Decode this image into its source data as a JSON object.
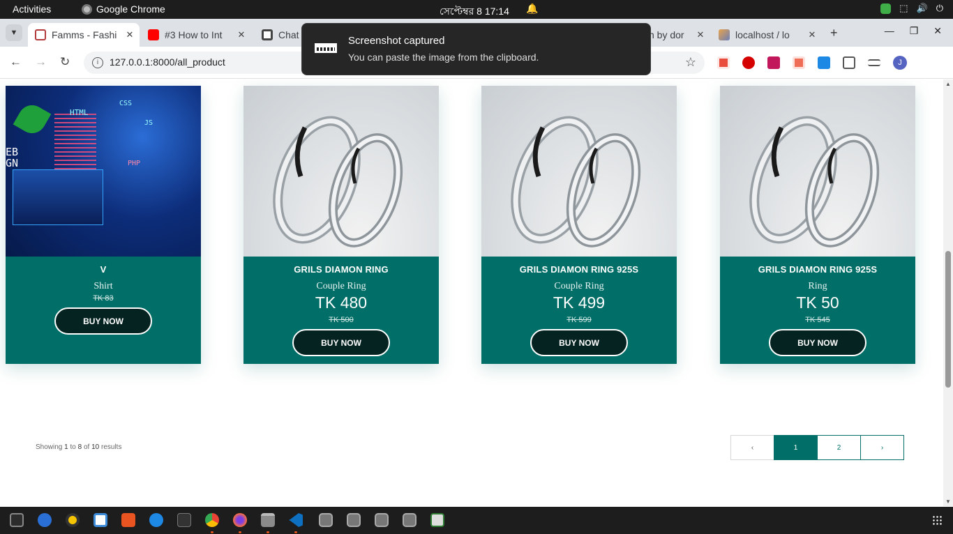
{
  "system_bar": {
    "activities": "Activities",
    "app_name": "Google Chrome",
    "clock": "সেপ্টেম্বর 8  17:14"
  },
  "tabs": [
    {
      "title": "Famms - Fashi",
      "active": true,
      "icon": "famms-favicon"
    },
    {
      "title": "#3 How to Int",
      "active": false,
      "icon": "youtube-icon"
    },
    {
      "title": "Chat",
      "active": false,
      "icon": "chatgpt-icon"
    },
    {
      "title": "n by dor",
      "active": false,
      "icon": "generic-favicon"
    },
    {
      "title": "localhost / lo",
      "active": false,
      "icon": "phpmyadmin-icon"
    }
  ],
  "toolbar": {
    "url": "127.0.0.1:8000/all_product"
  },
  "notification": {
    "title": "Screenshot captured",
    "body": "You can paste the image from the clipboard."
  },
  "products": [
    {
      "name": "V",
      "category": "Shirt",
      "price": "",
      "old_price": "TK 83",
      "button": "BUY NOW",
      "image": "web-development-image"
    },
    {
      "name": "GRILS DIAMON RING",
      "category": "Couple Ring",
      "price": "TK 480",
      "old_price": "TK 500",
      "button": "BUY NOW",
      "image": "silver-rings-image"
    },
    {
      "name": "GRILS DIAMON RING 925S",
      "category": "Couple Ring",
      "price": "TK 499",
      "old_price": "TK 599",
      "button": "BUY NOW",
      "image": "silver-rings-image"
    },
    {
      "name": "GRILS DIAMON RING 925S",
      "category": "Ring",
      "price": "TK 50",
      "old_price": "TK 545",
      "button": "BUY NOW",
      "image": "silver-rings-image"
    }
  ],
  "web_image_labels": {
    "html": "HTML",
    "css": "CSS",
    "js": "JS",
    "php": "PHP",
    "web": "EB",
    "gn": "GN"
  },
  "pagination": {
    "showing_prefix": "Showing",
    "from": "1",
    "to_word": "to",
    "to": "8",
    "of_word": "of",
    "total": "10",
    "suffix": "results",
    "prev": "‹",
    "pages": [
      "1",
      "2"
    ],
    "next": "›",
    "current_page": 1
  },
  "colors": {
    "brand": "#016f67",
    "button": "#052321"
  }
}
